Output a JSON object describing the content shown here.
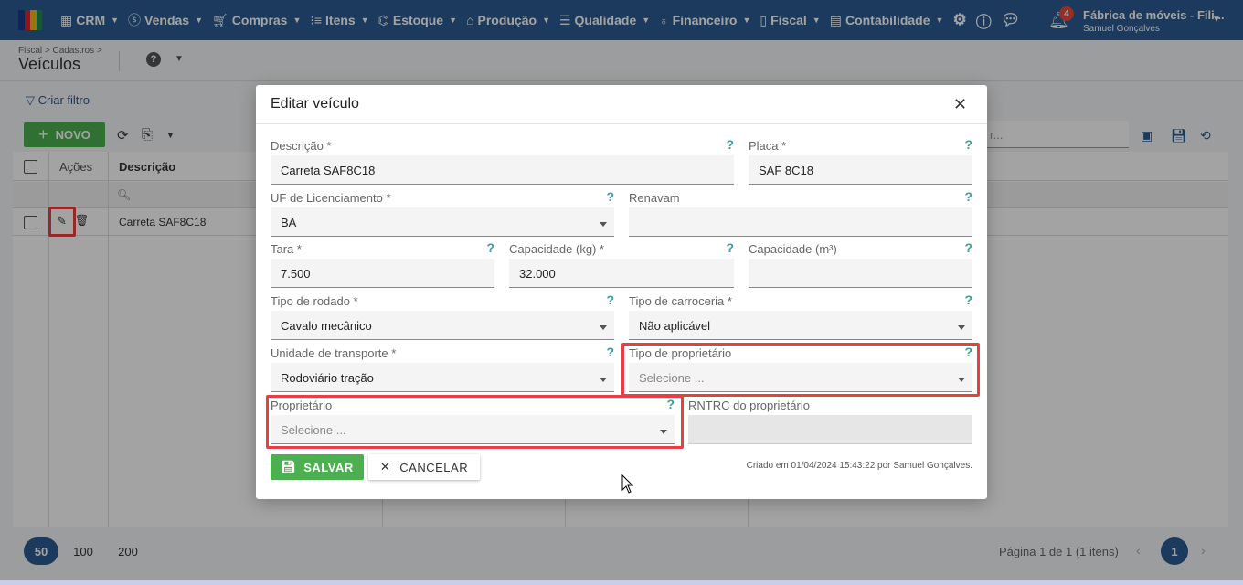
{
  "nav": {
    "items": [
      {
        "label": "CRM",
        "icon": "crm-icon"
      },
      {
        "label": "Vendas",
        "icon": "dollar-icon"
      },
      {
        "label": "Compras",
        "icon": "cart-icon"
      },
      {
        "label": "Itens",
        "icon": "items-icon"
      },
      {
        "label": "Estoque",
        "icon": "stock-icon"
      },
      {
        "label": "Produção",
        "icon": "factory-icon"
      },
      {
        "label": "Qualidade",
        "icon": "quality-icon"
      },
      {
        "label": "Financeiro",
        "icon": "money-bag-icon"
      },
      {
        "label": "Fiscal",
        "icon": "fiscal-doc-icon"
      },
      {
        "label": "Contabilidade",
        "icon": "calculator-icon"
      }
    ],
    "notification_count": "4",
    "company": "Fábrica de móveis - Fili...",
    "user": "Samuel Gonçalves",
    "brand_color": "#2b5c92"
  },
  "page": {
    "breadcrumb": "Fiscal > Cadastros >",
    "title": "Veículos",
    "help": "?"
  },
  "toolbar": {
    "filter_label": "Criar filtro",
    "new_label": "NOVO",
    "search_placeholder": "r..."
  },
  "grid": {
    "columns": {
      "actions": "Ações",
      "description": "Descrição"
    },
    "rows": [
      {
        "description": "Carreta SAF8C18"
      }
    ]
  },
  "pagination": {
    "sizes": [
      "50",
      "100",
      "200"
    ],
    "info": "Página 1 de 1 (1 itens)",
    "current": "1"
  },
  "modal": {
    "title": "Editar veículo",
    "help": "?",
    "fields": {
      "descricao": {
        "label": "Descrição *",
        "value": "Carreta SAF8C18"
      },
      "placa": {
        "label": "Placa *",
        "value": "SAF 8C18"
      },
      "uf": {
        "label": "UF de Licenciamento *",
        "value": "BA"
      },
      "renavam": {
        "label": "Renavam",
        "value": ""
      },
      "tara": {
        "label": "Tara *",
        "value": "7.500"
      },
      "capacidade_kg": {
        "label": "Capacidade (kg) *",
        "value": "32.000"
      },
      "capacidade_m3": {
        "label": "Capacidade (m³)",
        "value": ""
      },
      "tipo_rodado": {
        "label": "Tipo de rodado *",
        "value": "Cavalo mecânico"
      },
      "tipo_carroceria": {
        "label": "Tipo de carroceria *",
        "value": "Não aplicável"
      },
      "unidade_transporte": {
        "label": "Unidade de transporte *",
        "value": "Rodoviário tração"
      },
      "tipo_proprietario": {
        "label": "Tipo de proprietário",
        "placeholder": "Selecione ..."
      },
      "proprietario": {
        "label": "Proprietário",
        "placeholder": "Selecione ..."
      },
      "rntrc": {
        "label": "RNTRC do proprietário",
        "value": ""
      }
    },
    "save_label": "SALVAR",
    "cancel_label": "CANCELAR",
    "audit": "Criado em 01/04/2024 15:43:22 por Samuel Gonçalves."
  }
}
